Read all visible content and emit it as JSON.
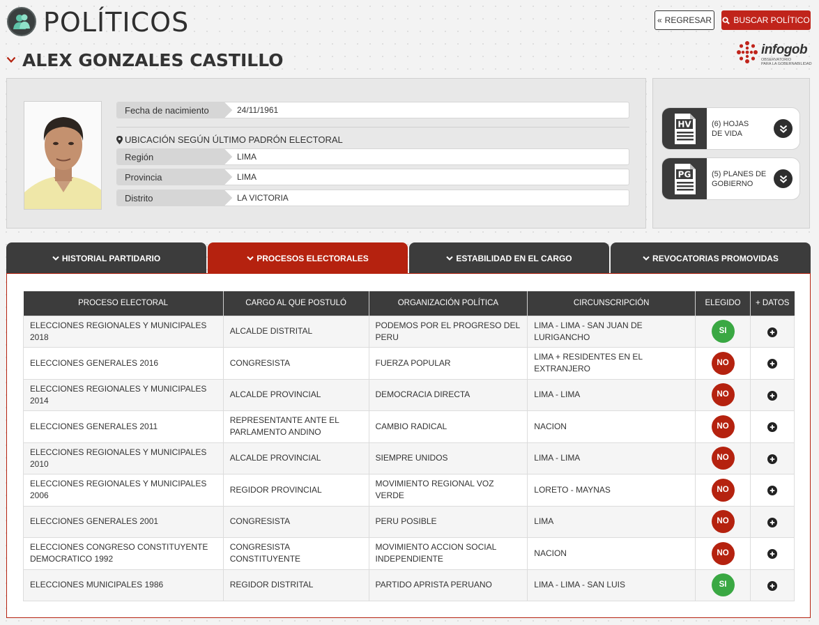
{
  "header": {
    "title": "POLÍTICOS",
    "person_name": "ALEX GONZALES CASTILLO",
    "back_label": "REGRESAR",
    "search_label": "BUSCAR POLÍTICO",
    "brand": "infogob",
    "brand_sub_1": "OBSERVATORIO",
    "brand_sub_2": "PARA LA GOBERNABILIDAD"
  },
  "profile": {
    "birth_label": "Fecha de nacimiento",
    "birth_value": "24/11/1961",
    "location_title": "UBICACIÓN SEGÚN ÚLTIMO PADRÓN ELECTORAL",
    "region_label": "Región",
    "region_value": "LIMA",
    "province_label": "Provincia",
    "province_value": "LIMA",
    "district_label": "Distrito",
    "district_value": "LA VICTORIA"
  },
  "docs": {
    "hv_icon_text": "HV",
    "hv_line1": "(6) HOJAS",
    "hv_line2": "DE VIDA",
    "pg_icon_text": "PG",
    "pg_line1": "(5) PLANES DE",
    "pg_line2": "GOBIERNO"
  },
  "tabs": [
    {
      "label": "HISTORIAL PARTIDARIO",
      "active": false
    },
    {
      "label": "PROCESOS ELECTORALES",
      "active": true
    },
    {
      "label": "ESTABILIDAD EN EL CARGO",
      "active": false
    },
    {
      "label": "REVOCATORIAS PROMOVIDAS",
      "active": false
    }
  ],
  "table": {
    "headers": [
      "PROCESO ELECTORAL",
      "CARGO AL QUE POSTULÓ",
      "ORGANIZACIÓN POLÍTICA",
      "CIRCUNSCRIPCIÓN",
      "ELEGIDO",
      "+ DATOS"
    ],
    "rows": [
      {
        "proceso": "ELECCIONES REGIONALES Y MUNICIPALES 2018",
        "cargo": "ALCALDE DISTRITAL",
        "org": "PODEMOS POR EL PROGRESO DEL PERU",
        "circ": "LIMA - LIMA - SAN JUAN DE LURIGANCHO",
        "elegido": "SI"
      },
      {
        "proceso": "ELECCIONES GENERALES 2016",
        "cargo": "CONGRESISTA",
        "org": "FUERZA POPULAR",
        "circ": "LIMA + RESIDENTES EN EL EXTRANJERO",
        "elegido": "NO"
      },
      {
        "proceso": "ELECCIONES REGIONALES Y MUNICIPALES 2014",
        "cargo": "ALCALDE PROVINCIAL",
        "org": "DEMOCRACIA DIRECTA",
        "circ": "LIMA - LIMA",
        "elegido": "NO"
      },
      {
        "proceso": "ELECCIONES GENERALES 2011",
        "cargo": "REPRESENTANTE ANTE EL PARLAMENTO ANDINO",
        "org": "CAMBIO RADICAL",
        "circ": "NACION",
        "elegido": "NO"
      },
      {
        "proceso": "ELECCIONES REGIONALES Y MUNICIPALES 2010",
        "cargo": "ALCALDE PROVINCIAL",
        "org": "SIEMPRE UNIDOS",
        "circ": "LIMA - LIMA",
        "elegido": "NO"
      },
      {
        "proceso": "ELECCIONES REGIONALES Y MUNICIPALES 2006",
        "cargo": "REGIDOR PROVINCIAL",
        "org": "MOVIMIENTO REGIONAL VOZ VERDE",
        "circ": "LORETO - MAYNAS",
        "elegido": "NO"
      },
      {
        "proceso": "ELECCIONES GENERALES 2001",
        "cargo": "CONGRESISTA",
        "org": "PERU POSIBLE",
        "circ": "LIMA",
        "elegido": "NO"
      },
      {
        "proceso": "ELECCIONES CONGRESO CONSTITUYENTE DEMOCRATICO 1992",
        "cargo": "CONGRESISTA CONSTITUYENTE",
        "org": "MOVIMIENTO ACCION SOCIAL INDEPENDIENTE",
        "circ": "NACION",
        "elegido": "NO"
      },
      {
        "proceso": "ELECCIONES MUNICIPALES 1986",
        "cargo": "REGIDOR DISTRITAL",
        "org": "PARTIDO APRISTA PERUANO",
        "circ": "LIMA - LIMA - SAN LUIS",
        "elegido": "SI"
      }
    ]
  },
  "colors": {
    "accent": "#b5220f",
    "dark": "#3c3c3c",
    "yes": "#3aa843"
  }
}
